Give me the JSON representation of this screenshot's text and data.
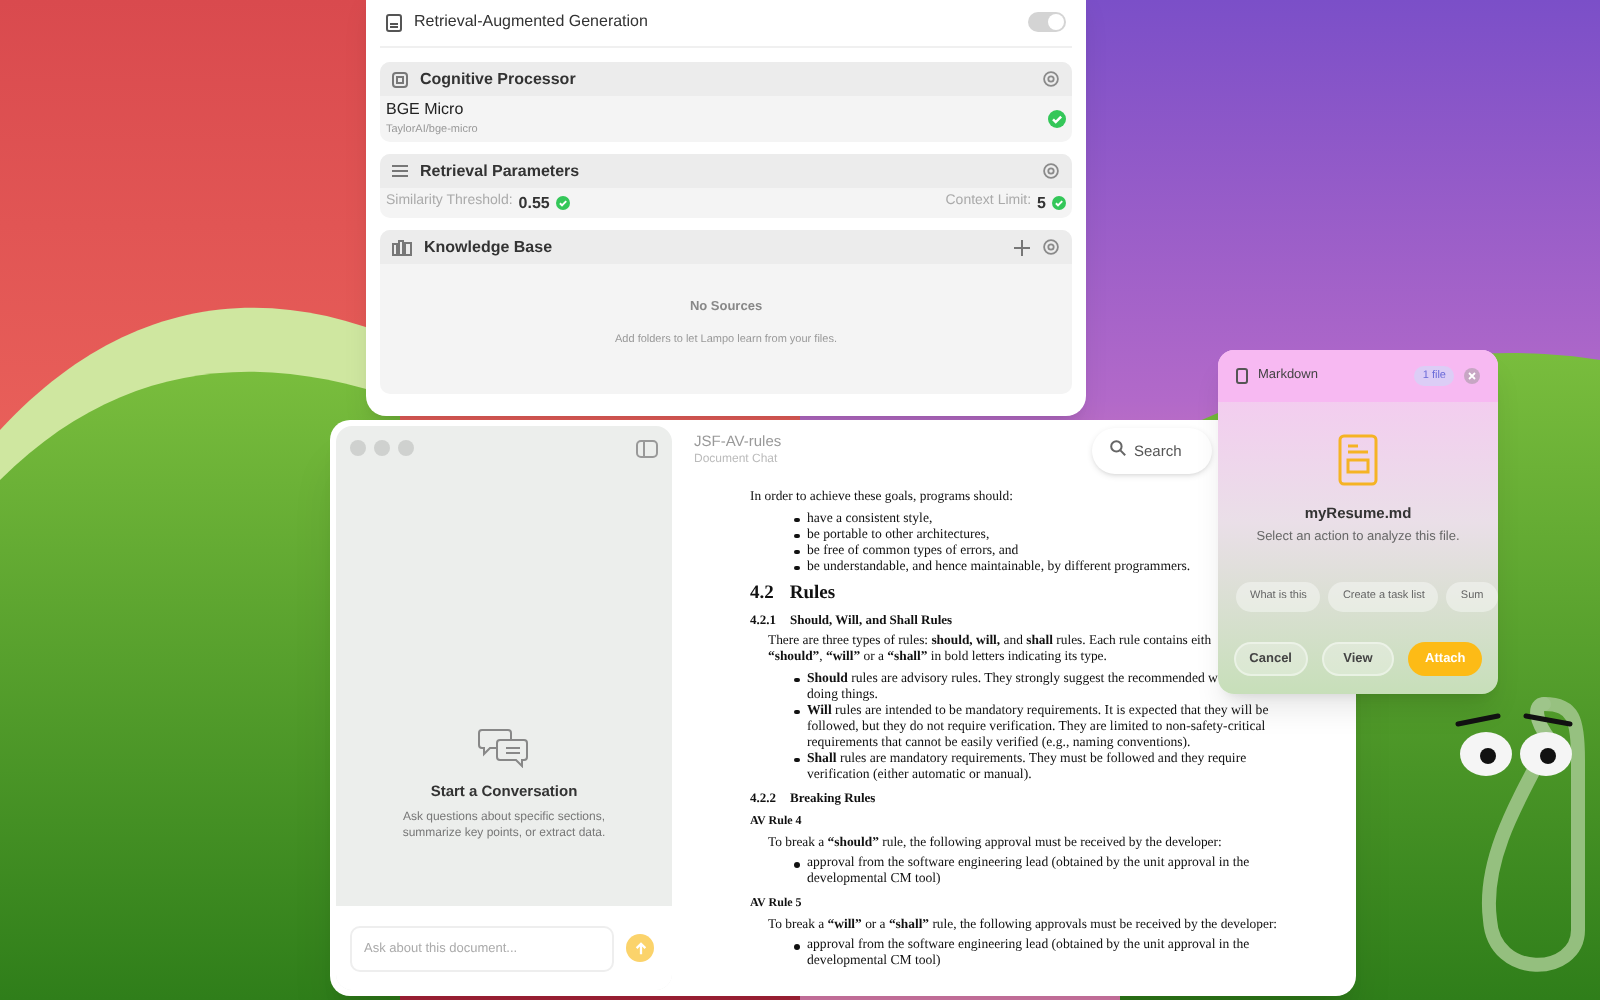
{
  "settings": {
    "rag": {
      "label": "Retrieval-Augmented Generation",
      "on": true
    },
    "cognitive_processor": {
      "title": "Cognitive Processor",
      "model_name": "BGE Micro",
      "model_id": "TaylorAI/bge-micro"
    },
    "retrieval_parameters": {
      "title": "Retrieval Parameters",
      "params": [
        {
          "label": "Similarity Threshold:",
          "value": "0.55"
        },
        {
          "label": "Context Limit:",
          "value": "5"
        }
      ]
    },
    "knowledge_base": {
      "title": "Knowledge Base",
      "empty_title": "No Sources",
      "empty_text": "Add folders to let Lampo learn from your files."
    }
  },
  "chat": {
    "empty_title": "Start a Conversation",
    "empty_text": "Ask questions about specific sections, summarize key points, or extract data.",
    "input": {
      "placeholder": "Ask about this document..."
    }
  },
  "document": {
    "title": "JSF-AV-rules",
    "subtitle": "Document Chat",
    "search": {
      "placeholder": "Search"
    },
    "blocks": [
      {
        "kind": "para",
        "lines": [
          "In order to achieve these goals, programs should:"
        ]
      },
      {
        "kind": "bullets",
        "items": [
          "have a consistent style,",
          "be portable to other architectures,",
          "be free of common types of errors, and",
          "be understandable, and hence maintainable, by different programmers."
        ]
      },
      {
        "kind": "h2",
        "number": "4.2",
        "text": "Rules"
      },
      {
        "kind": "h3",
        "number": "4.2.1",
        "text": "Should, Will, and Shall Rules"
      },
      {
        "kind": "indent",
        "lines": [
          "There are three types of rules: **should, will,** and **shall** rules.  Each rule contains eith",
          "**“should”**, **“will”** or a **“shall”** in bold letters indicating its type."
        ]
      },
      {
        "kind": "bullets",
        "items": [
          "**Should** rules are advisory rules.  They strongly suggest the recommended w\ndoing things.",
          "**Will** rules are intended to be mandatory requirements. It is expected that they will be followed, but they do not require verification. They are limited to non-safety-critical requirements that cannot be easily verified (e.g., naming conventions).",
          "**Shall** rules are mandatory requirements.  They must be followed and they require verification (either automatic or manual)."
        ]
      },
      {
        "kind": "h3",
        "number": "4.2.2",
        "text": "Breaking Rules"
      },
      {
        "kind": "h4",
        "text": "AV Rule 4"
      },
      {
        "kind": "indent",
        "lines": [
          "To break a **“should”** rule, the following approval must be received by the developer:"
        ]
      },
      {
        "kind": "bullets",
        "items": [
          "approval from the software engineering lead (obtained by the unit approval in the developmental CM tool)"
        ]
      },
      {
        "kind": "h4",
        "text": "AV Rule 5"
      },
      {
        "kind": "indent",
        "lines": [
          "To break a **“will”** or a **“shall”** rule, the following approvals must be received by the developer:"
        ]
      },
      {
        "kind": "bullets",
        "items": [
          "approval from the software engineering lead (obtained by the unit approval in the developmental CM tool)"
        ]
      }
    ]
  },
  "popup": {
    "title": "Markdown",
    "badge": "1 file",
    "file_name": "myResume.md",
    "prompt": "Select an action to analyze this file.",
    "actions": [
      "What is this",
      "Create a task list",
      "Sum"
    ],
    "buttons": [
      {
        "label": "Cancel",
        "kind": "secondary"
      },
      {
        "label": "View",
        "kind": "secondary"
      },
      {
        "label": "Attach",
        "kind": "primary"
      }
    ]
  }
}
